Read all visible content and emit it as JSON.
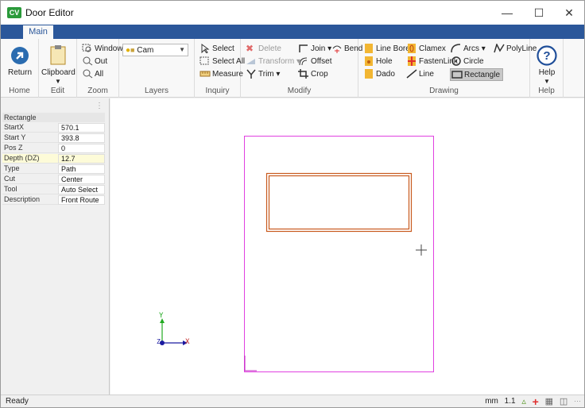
{
  "window": {
    "app_badge": "CV",
    "title": "Door Editor"
  },
  "tabs": [
    {
      "label": "Main"
    }
  ],
  "ribbon": {
    "home": {
      "return_label": "Return",
      "group": "Home"
    },
    "edit": {
      "clipboard_label": "Clipboard",
      "group": "Edit"
    },
    "zoom": {
      "window": "Window",
      "out": "Out",
      "all": "All",
      "group": "Zoom"
    },
    "layers": {
      "selected": "Cam",
      "group": "Layers"
    },
    "inquiry": {
      "select": "Select",
      "select_all": "Select All",
      "measure": "Measure",
      "group": "Inquiry"
    },
    "modify": {
      "delete": "Delete",
      "transform": "Transform",
      "trim": "Trim",
      "join": "Join",
      "bend": "Bend",
      "offset": "Offset",
      "crop": "Crop",
      "group": "Modify"
    },
    "drawing": {
      "line_bore": "Line Bore",
      "hole": "Hole",
      "dado": "Dado",
      "clamex": "Clamex",
      "fastenlink": "FastenLink",
      "line": "Line",
      "arcs": "Arcs",
      "circle": "Circle",
      "rectangle": "Rectangle",
      "polyline": "PolyLine",
      "group": "Drawing"
    },
    "help": {
      "label": "Help",
      "group": "Help"
    }
  },
  "properties": {
    "header": "Rectangle",
    "rows": [
      {
        "key": "StartX",
        "value": "570.1"
      },
      {
        "key": "Start Y",
        "value": "393.8"
      },
      {
        "key": "Pos Z",
        "value": "0"
      },
      {
        "key": "Depth (DZ)",
        "value": "12.7"
      },
      {
        "key": "Type",
        "value": "Path"
      },
      {
        "key": "Cut",
        "value": "Center"
      },
      {
        "key": "Tool",
        "value": "Auto Select"
      },
      {
        "key": "Description",
        "value": "Front Route"
      }
    ]
  },
  "canvas": {
    "axis_y": "Y",
    "axis_x": "X",
    "axis_z": "Z",
    "door_color": "#e040e0",
    "route_color": "#c85a1e"
  },
  "status": {
    "text": "Ready",
    "units": "mm",
    "zoom": "1.1"
  }
}
